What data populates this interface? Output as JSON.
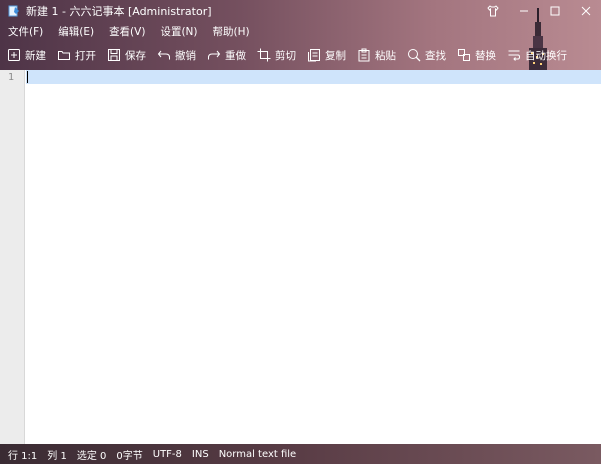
{
  "window": {
    "title": "新建 1 - 六六记事本 [Administrator]"
  },
  "menu": [
    {
      "label": "文件(F)",
      "name": "menu-file"
    },
    {
      "label": "编辑(E)",
      "name": "menu-edit"
    },
    {
      "label": "查看(V)",
      "name": "menu-view"
    },
    {
      "label": "设置(N)",
      "name": "menu-settings"
    },
    {
      "label": "帮助(H)",
      "name": "menu-help"
    }
  ],
  "toolbar": [
    {
      "label": "新建",
      "icon": "new-file-icon"
    },
    {
      "label": "打开",
      "icon": "folder-open-icon"
    },
    {
      "label": "保存",
      "icon": "save-icon"
    },
    {
      "label": "撤销",
      "icon": "undo-icon"
    },
    {
      "label": "重做",
      "icon": "redo-icon"
    },
    {
      "label": "剪切",
      "icon": "crop-icon"
    },
    {
      "label": "复制",
      "icon": "copy-icon"
    },
    {
      "label": "粘贴",
      "icon": "paste-icon"
    },
    {
      "label": "查找",
      "icon": "search-icon"
    },
    {
      "label": "替换",
      "icon": "replace-icon"
    },
    {
      "label": "自动换行",
      "icon": "word-wrap-icon"
    }
  ],
  "editor": {
    "line_number": "1"
  },
  "status": {
    "row": "行 1:1",
    "col": "列 1",
    "selection": "选定 0",
    "bytes": "0字节",
    "encoding": "UTF-8",
    "mode": "INS",
    "filetype": "Normal text file"
  },
  "colors": {
    "current_line": "#cfe4fb",
    "gutter": "#ececec"
  }
}
